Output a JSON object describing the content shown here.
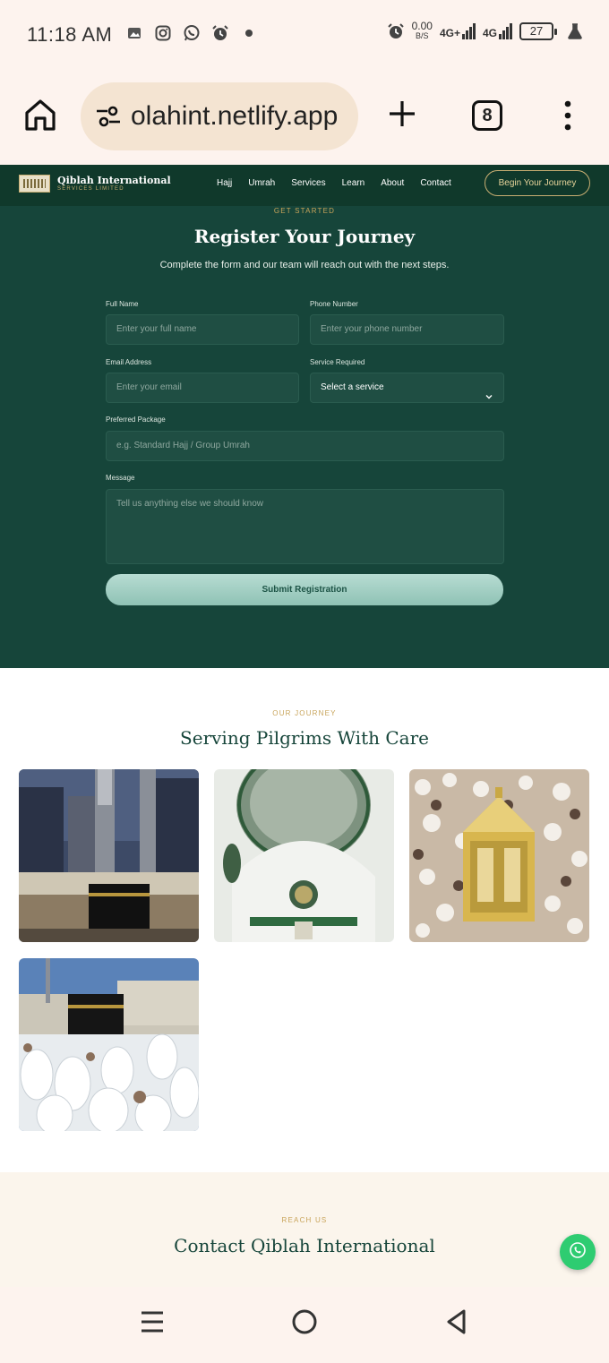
{
  "status_bar": {
    "time": "11:18 AM",
    "net_speed_value": "0.00",
    "net_speed_unit": "B/S",
    "net1": "4G+",
    "net2": "4G",
    "battery": "27",
    "left_icons": [
      "gallery-icon",
      "instagram-icon",
      "whatsapp-icon",
      "alarm-icon",
      "dot-icon"
    ],
    "right_icons": [
      "alarm-icon",
      "signal-icon",
      "battery-icon",
      "flask-icon"
    ]
  },
  "browser": {
    "url": "olahint.netlify.app",
    "tab_count": "8"
  },
  "site_nav": {
    "brand": "Qiblah International",
    "brand_sub": "SERVICES LIMITED",
    "links": [
      "Hajj",
      "Umrah",
      "Services",
      "Learn",
      "About",
      "Contact"
    ],
    "cta": "Begin Your Journey"
  },
  "register": {
    "eyebrow": "GET STARTED",
    "title": "Register Your Journey",
    "subtitle": "Complete the form and our team will reach out with the next steps.",
    "fields": {
      "full_name": {
        "label": "Full Name",
        "placeholder": "Enter your full name"
      },
      "phone": {
        "label": "Phone Number",
        "placeholder": "Enter your phone number"
      },
      "email": {
        "label": "Email Address",
        "placeholder": "Enter your email"
      },
      "service": {
        "label": "Service Required",
        "value": "Select a service"
      },
      "package": {
        "label": "Preferred Package",
        "placeholder": "e.g. Standard Hajj / Group Umrah"
      },
      "message": {
        "label": "Message",
        "placeholder": "Tell us anything else we should know"
      }
    },
    "submit": "Submit Registration"
  },
  "journey": {
    "eyebrow": "OUR JOURNEY",
    "title": "Serving Pilgrims With Care"
  },
  "contact": {
    "eyebrow": "REACH US",
    "title": "Contact Qiblah International"
  },
  "colors": {
    "dark_green": "#10392b",
    "section_green": "#16453a",
    "gold": "#c8a45a",
    "whatsapp": "#2ecc71"
  }
}
